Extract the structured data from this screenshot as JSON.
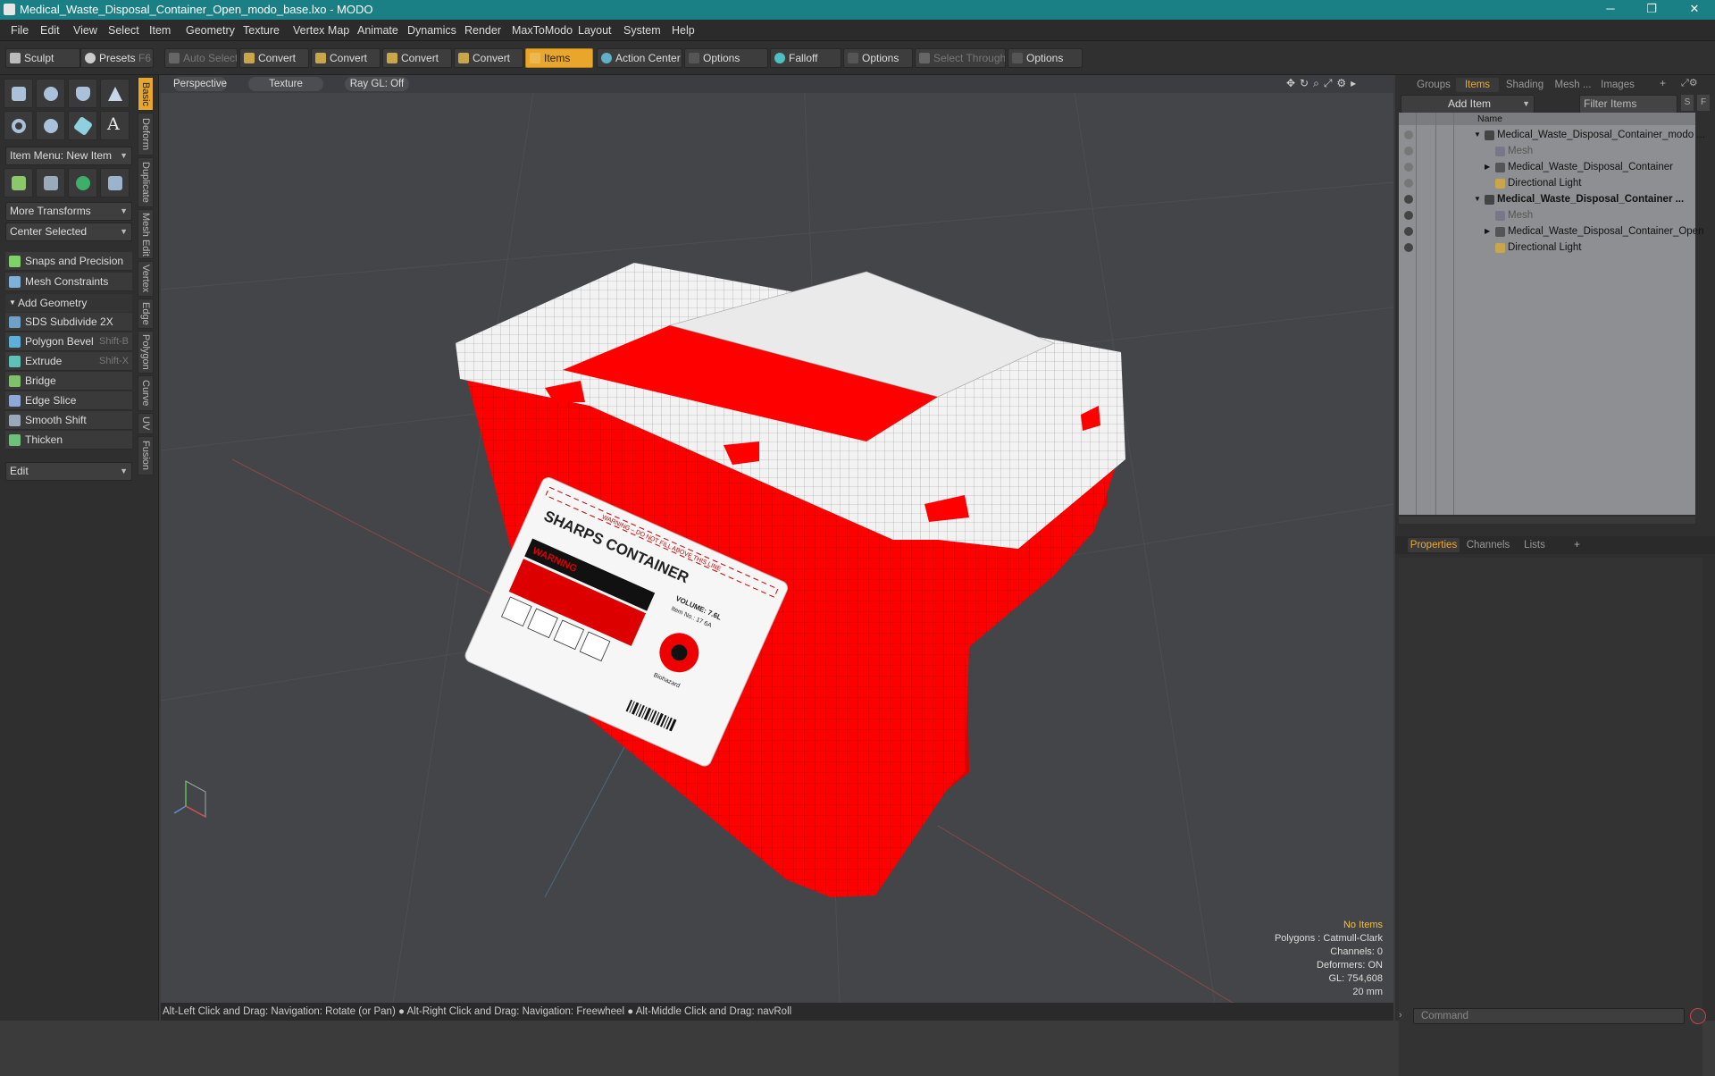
{
  "window": {
    "title": "Medical_Waste_Disposal_Container_Open_modo_base.lxo - MODO",
    "minimize": "─",
    "maximize": "❐",
    "close": "✕"
  },
  "menu": [
    "File",
    "Edit",
    "View",
    "Select",
    "Item",
    "Geometry",
    "Texture",
    "Vertex Map",
    "Animate",
    "Dynamics",
    "Render",
    "MaxToModo",
    "Layout",
    "System",
    "Help"
  ],
  "toolbar": {
    "sculpt": "Sculpt",
    "presets": "Presets",
    "presets_key": "F6",
    "auto_select": "Auto Select",
    "convert1": "Convert",
    "convert2": "Convert",
    "convert3": "Convert",
    "convert4": "Convert",
    "items": "Items",
    "action_center": "Action Center",
    "options1": "Options",
    "falloff": "Falloff",
    "options2": "Options",
    "select_through": "Select Through",
    "options3": "Options"
  },
  "left": {
    "item_menu": "Item Menu: New Item",
    "more_transforms": "More Transforms",
    "center_selected": "Center Selected",
    "snaps": "Snaps and Precision",
    "mesh_constraints": "Mesh Constraints",
    "add_geometry": "Add Geometry",
    "tools": [
      {
        "label": "SDS Subdivide 2X",
        "shortcut": ""
      },
      {
        "label": "Polygon Bevel",
        "shortcut": "Shift-B"
      },
      {
        "label": "Extrude",
        "shortcut": "Shift-X"
      },
      {
        "label": "Bridge",
        "shortcut": ""
      },
      {
        "label": "Edge Slice",
        "shortcut": ""
      },
      {
        "label": "Smooth Shift",
        "shortcut": ""
      },
      {
        "label": "Thicken",
        "shortcut": ""
      }
    ],
    "edit": "Edit",
    "vtabs": [
      "Basic",
      "Deform",
      "Duplicate",
      "Mesh Edit",
      "Vertex",
      "Edge",
      "Polygon",
      "Curve",
      "UV",
      "Fusion"
    ]
  },
  "viewport": {
    "perspective": "Perspective",
    "texture": "Texture",
    "raygl": "Ray GL: Off",
    "label_warning": "WARNING – DO NOT FILL ABOVE THIS LINE",
    "label_title": "SHARPS CONTAINER",
    "label_warning2": "WARNING",
    "label_volume": "VOLUME: 7.6L",
    "label_item": "Item No.: 17 6A",
    "label_biohazard": "Biohazard",
    "stats": {
      "items": "No Items",
      "polygons": "Polygons : Catmull-Clark",
      "channels": "Channels: 0",
      "deformers": "Deformers: ON",
      "gl": "GL: 754,608",
      "scale": "20 mm"
    }
  },
  "status": "Alt-Left Click and Drag: Navigation: Rotate (or Pan) ● Alt-Right Click and Drag: Navigation: Freewheel ● Alt-Middle Click and Drag: navRoll",
  "right": {
    "tabs": [
      "Groups",
      "Items",
      "Shading",
      "Mesh ...",
      "Images"
    ],
    "add_item": "Add Item",
    "filter": "Filter Items",
    "name_col": "Name",
    "tree": [
      {
        "label": "Medical_Waste_Disposal_Container_modo ...",
        "level": 0,
        "bold": false,
        "dim": false
      },
      {
        "label": "Mesh",
        "level": 1,
        "bold": false,
        "dim": true
      },
      {
        "label": "Medical_Waste_Disposal_Container",
        "level": 1,
        "bold": false,
        "dim": false
      },
      {
        "label": "Directional Light",
        "level": 1,
        "bold": false,
        "dim": false
      },
      {
        "label": "Medical_Waste_Disposal_Container ...",
        "level": 0,
        "bold": true,
        "dim": false
      },
      {
        "label": "Mesh",
        "level": 1,
        "bold": false,
        "dim": true
      },
      {
        "label": "Medical_Waste_Disposal_Container_Open",
        "level": 1,
        "bold": false,
        "dim": false
      },
      {
        "label": "Directional Light",
        "level": 1,
        "bold": false,
        "dim": false
      }
    ],
    "bottom_tabs": [
      "Properties",
      "Channels",
      "Lists"
    ],
    "command": "Command"
  }
}
